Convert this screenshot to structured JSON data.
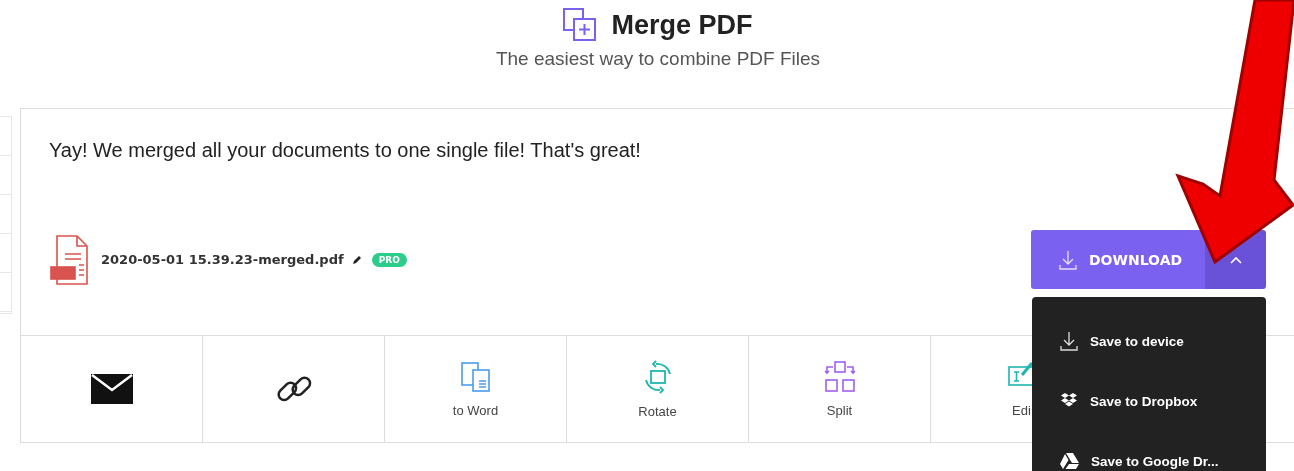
{
  "header": {
    "title": "Merge PDF",
    "subtitle": "The easiest way to combine PDF Files"
  },
  "result": {
    "message": "Yay! We merged all your documents to one single file! That's great!",
    "file": {
      "name": "2020-05-01 15.39.23-merged.pdf",
      "badge": "PRO"
    },
    "download": {
      "label": "DOWNLOAD",
      "expanded": true,
      "menu": [
        {
          "kind": "device",
          "label": "Save to device"
        },
        {
          "kind": "dropbox",
          "label": "Save to Dropbox"
        },
        {
          "kind": "drive",
          "label": "Save to Google Dr..."
        }
      ]
    }
  },
  "tools": [
    {
      "kind": "email"
    },
    {
      "kind": "link"
    },
    {
      "kind": "word",
      "label": "to Word"
    },
    {
      "kind": "rotate",
      "label": "Rotate"
    },
    {
      "kind": "split",
      "label": "Split"
    },
    {
      "kind": "edit",
      "label": "Edi"
    }
  ]
}
